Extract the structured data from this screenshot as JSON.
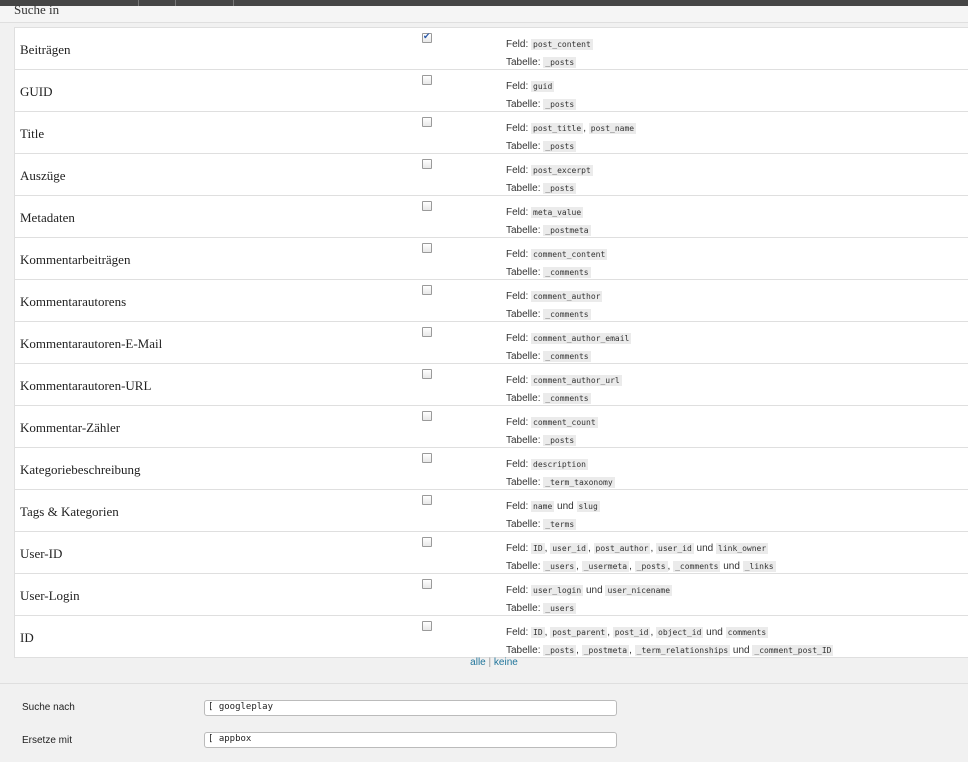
{
  "section": {
    "title": "Suche in"
  },
  "rows": [
    {
      "label": "Beiträgen",
      "checked": true,
      "feld": [
        [
          "code",
          "post_content"
        ]
      ],
      "tabelle": [
        [
          "code",
          "_posts"
        ]
      ]
    },
    {
      "label": "GUID",
      "checked": false,
      "feld": [
        [
          "code",
          "guid"
        ]
      ],
      "tabelle": [
        [
          "code",
          "_posts"
        ]
      ]
    },
    {
      "label": "Title",
      "checked": false,
      "feld": [
        [
          "code",
          "post_title"
        ],
        [
          "text",
          ", "
        ],
        [
          "code",
          "post_name"
        ]
      ],
      "tabelle": [
        [
          "code",
          "_posts"
        ]
      ]
    },
    {
      "label": "Auszüge",
      "checked": false,
      "feld": [
        [
          "code",
          "post_excerpt"
        ]
      ],
      "tabelle": [
        [
          "code",
          "_posts"
        ]
      ]
    },
    {
      "label": "Metadaten",
      "checked": false,
      "feld": [
        [
          "code",
          "meta_value"
        ]
      ],
      "tabelle": [
        [
          "code",
          "_postmeta"
        ]
      ]
    },
    {
      "label": "Kommentarbeiträgen",
      "checked": false,
      "feld": [
        [
          "code",
          "comment_content"
        ]
      ],
      "tabelle": [
        [
          "code",
          "_comments"
        ]
      ]
    },
    {
      "label": "Kommentarautorens",
      "checked": false,
      "feld": [
        [
          "code",
          "comment_author"
        ]
      ],
      "tabelle": [
        [
          "code",
          "_comments"
        ]
      ]
    },
    {
      "label": "Kommentarautoren-E-Mail",
      "checked": false,
      "feld": [
        [
          "code",
          "comment_author_email"
        ]
      ],
      "tabelle": [
        [
          "code",
          "_comments"
        ]
      ]
    },
    {
      "label": "Kommentarautoren-URL",
      "checked": false,
      "feld": [
        [
          "code",
          "comment_author_url"
        ]
      ],
      "tabelle": [
        [
          "code",
          "_comments"
        ]
      ]
    },
    {
      "label": "Kommentar-Zähler",
      "checked": false,
      "feld": [
        [
          "code",
          "comment_count"
        ]
      ],
      "tabelle": [
        [
          "code",
          "_posts"
        ]
      ]
    },
    {
      "label": "Kategoriebeschreibung",
      "checked": false,
      "feld": [
        [
          "code",
          "description"
        ]
      ],
      "tabelle": [
        [
          "code",
          "_term_taxonomy"
        ]
      ]
    },
    {
      "label": "Tags & Kategorien",
      "checked": false,
      "feld": [
        [
          "code",
          "name"
        ],
        [
          "text",
          " und "
        ],
        [
          "code",
          "slug"
        ]
      ],
      "tabelle": [
        [
          "code",
          "_terms"
        ]
      ]
    },
    {
      "label": "User-ID",
      "checked": false,
      "feld": [
        [
          "code",
          "ID"
        ],
        [
          "text",
          ", "
        ],
        [
          "code",
          "user_id"
        ],
        [
          "text",
          ", "
        ],
        [
          "code",
          "post_author"
        ],
        [
          "text",
          ", "
        ],
        [
          "code",
          "user_id"
        ],
        [
          "text",
          " und "
        ],
        [
          "code",
          "link_owner"
        ]
      ],
      "tabelle": [
        [
          "code",
          "_users"
        ],
        [
          "text",
          ", "
        ],
        [
          "code",
          "_usermeta"
        ],
        [
          "text",
          ", "
        ],
        [
          "code",
          "_posts"
        ],
        [
          "text",
          ", "
        ],
        [
          "code",
          "_comments"
        ],
        [
          "text",
          " und "
        ],
        [
          "code",
          "_links"
        ]
      ]
    },
    {
      "label": "User-Login",
      "checked": false,
      "feld": [
        [
          "code",
          "user_login"
        ],
        [
          "text",
          " und "
        ],
        [
          "code",
          "user_nicename"
        ]
      ],
      "tabelle": [
        [
          "code",
          "_users"
        ]
      ]
    },
    {
      "label": "ID",
      "checked": false,
      "feld": [
        [
          "code",
          "ID"
        ],
        [
          "text",
          ", "
        ],
        [
          "code",
          "post_parent"
        ],
        [
          "text",
          ", "
        ],
        [
          "code",
          "post_id"
        ],
        [
          "text",
          ", "
        ],
        [
          "code",
          "object_id"
        ],
        [
          "text",
          " und "
        ],
        [
          "code",
          "comments"
        ]
      ],
      "tabelle": [
        [
          "code",
          "_posts"
        ],
        [
          "text",
          ", "
        ],
        [
          "code",
          "_postmeta"
        ],
        [
          "text",
          ", "
        ],
        [
          "code",
          "_term_relationships"
        ],
        [
          "text",
          " und "
        ],
        [
          "code",
          "_comment_post_ID"
        ]
      ]
    }
  ],
  "labels": {
    "feld": "Feld:",
    "tabelle": "Tabelle:"
  },
  "select": {
    "all": "alle",
    "separator": "|",
    "none": "keine"
  },
  "search": {
    "label": "Suche nach",
    "value": "[ googleplay"
  },
  "replace": {
    "label": "Ersetze mit",
    "value": "[ appbox"
  }
}
